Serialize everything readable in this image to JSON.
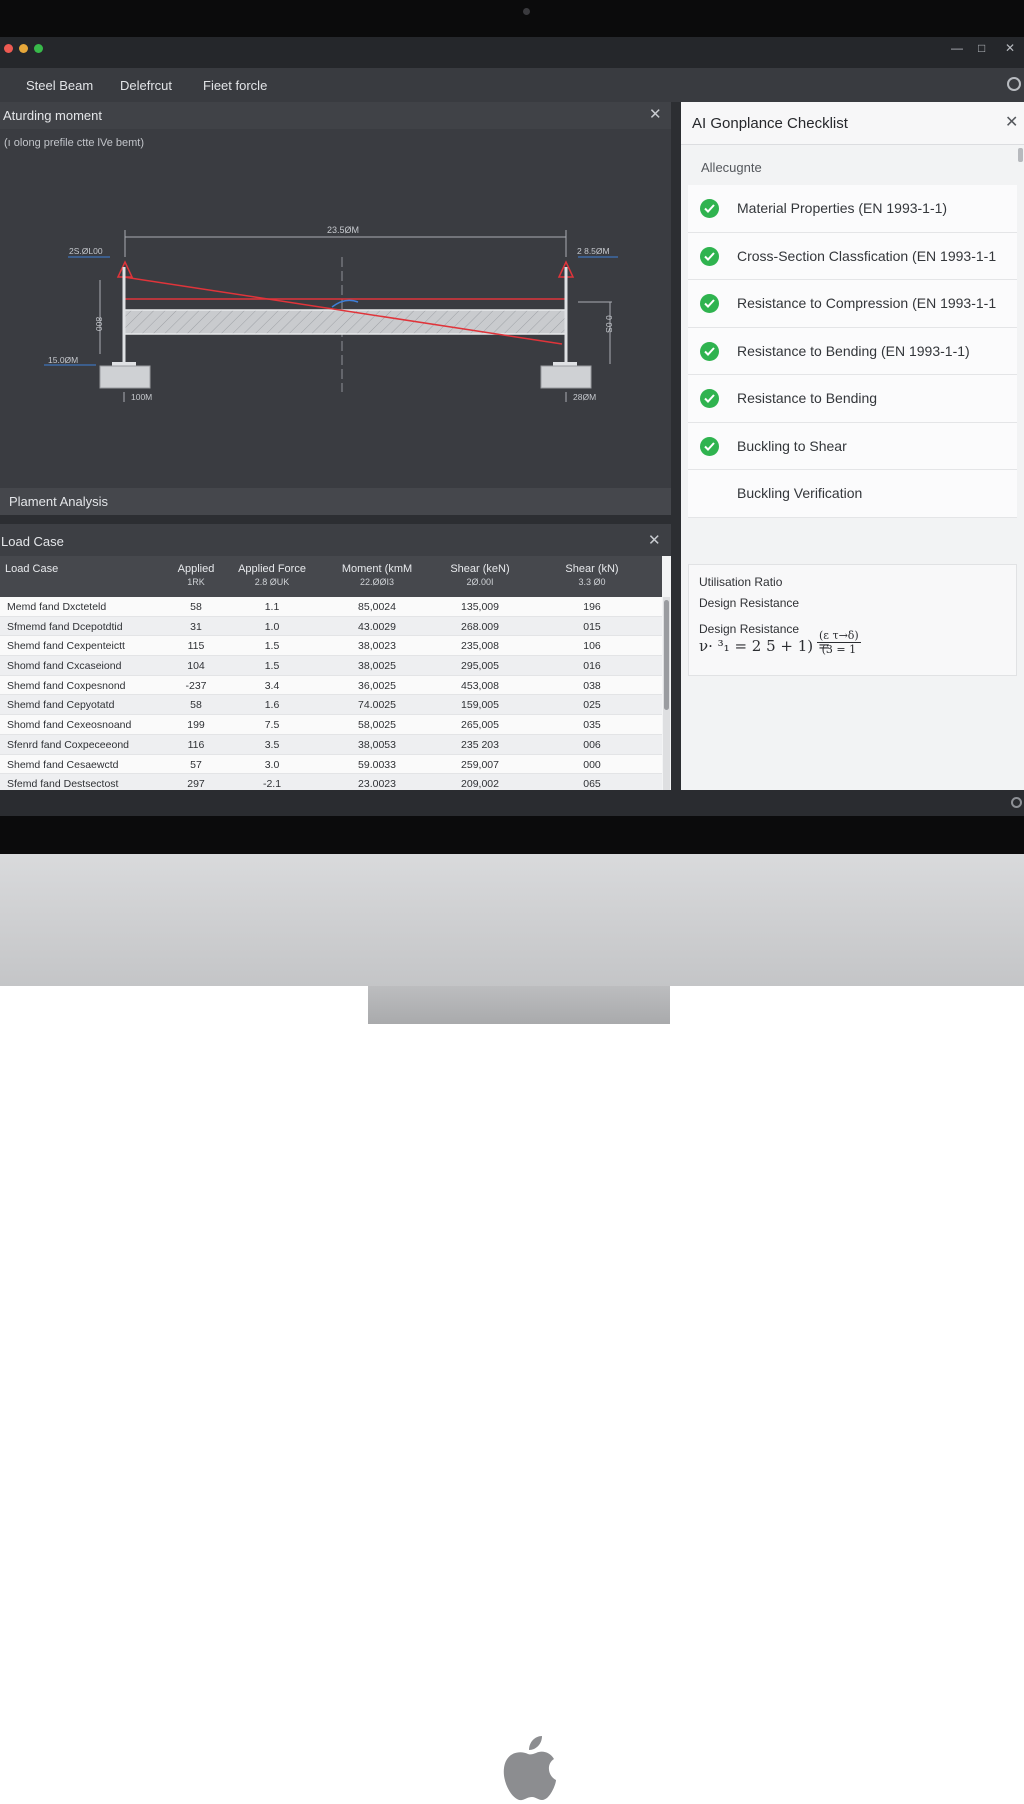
{
  "menu": {
    "items": [
      "Steel Beam",
      "Delefrcut",
      "Fieet forcle"
    ]
  },
  "moment_panel": {
    "title": "Aturding moment",
    "subtitle": "(ı olong prefile ctte lVe bemt)",
    "dims": {
      "span": "23.5ØM",
      "left_top": "2S.ØL00",
      "right_top": "2 8.5ØM",
      "left_side": "800",
      "right_side": "0 0S",
      "left_bottom": "15.0ØM",
      "left_base": "100M",
      "right_base": "28ØM"
    }
  },
  "analysis": {
    "label": "Plament Analysis"
  },
  "load_case": {
    "title": "Load Case",
    "columns": [
      {
        "label": "Load Case",
        "sub": ""
      },
      {
        "label": "Applied",
        "sub": "1RK"
      },
      {
        "label": "Applied Force",
        "sub": "2.8 ØUK"
      },
      {
        "label": "Moment (kmM",
        "sub": "22.ØØI3"
      },
      {
        "label": "Shear (keN)",
        "sub": "2Ø.00I"
      },
      {
        "label": "Shear (kN)",
        "sub": "3.3 Ø0"
      }
    ],
    "rows": [
      [
        "Memd fand Dxcteteld",
        "58",
        "1.1",
        "85,0024",
        "135,009",
        "196"
      ],
      [
        "Sfmemd fand Dcepotdtid",
        "31",
        "1.0",
        "43.0029",
        "268.009",
        "015"
      ],
      [
        "Shemd fand Cexpenteictt",
        "115",
        "1.5",
        "38,0023",
        "235,008",
        "106"
      ],
      [
        "Shomd fand Cxcaseiond",
        "104",
        "1.5",
        "38,0025",
        "295,005",
        "016"
      ],
      [
        "Shemd fand Coxpesnond",
        "-237",
        "3.4",
        "36,0025",
        "453,008",
        "038"
      ],
      [
        "Shemd fand Cepyotatd",
        "58",
        "1.6",
        "74.0025",
        "159,005",
        "025"
      ],
      [
        "Shomd fand Cexeosnoand",
        "199",
        "7.5",
        "58,0025",
        "265,005",
        "035"
      ],
      [
        "Sfenrd fand Coxpeceeond",
        "116",
        "3.5",
        "38,0053",
        "235 203",
        "006"
      ],
      [
        "Shemd fand Cesaewctd",
        "57",
        "3.0",
        "59.0033",
        "259,007",
        "000"
      ],
      [
        "Sfemd fand Destsectost",
        "297",
        "-2.1",
        "23.0023",
        "209,002",
        "065"
      ]
    ]
  },
  "checklist": {
    "title": "AI Gonplance Checklist",
    "subtitle": "Allecugnte",
    "items": [
      {
        "label": "Material Properties (EN 1993-1-1)",
        "checked": true
      },
      {
        "label": "Cross-Section Classfication (EN 1993-1-1",
        "checked": true
      },
      {
        "label": "Resistance to Compression (EN 1993-1-1",
        "checked": true
      },
      {
        "label": "Resistance to Bending (EN 1993-1-1)",
        "checked": true
      },
      {
        "label": "Resistance to Bending",
        "checked": true
      },
      {
        "label": "Buckling to Shear",
        "checked": true
      },
      {
        "label": "Buckling Verification",
        "checked": false
      }
    ],
    "utilisation": {
      "ratio_label": "Utilisation Ratio",
      "design_resistance_1": "Design Resistance",
      "design_resistance_2": "Design Resistance",
      "formula_lhs": "ν· ³₁ = 2 5 + 1) =",
      "formula_num": "(ε τ→δ)",
      "formula_den": "(3 = 1"
    }
  },
  "colors": {
    "accent_green": "#2fb34f",
    "load_arrow_red": "#e0343a",
    "dim_blue": "#3f7fd8"
  }
}
